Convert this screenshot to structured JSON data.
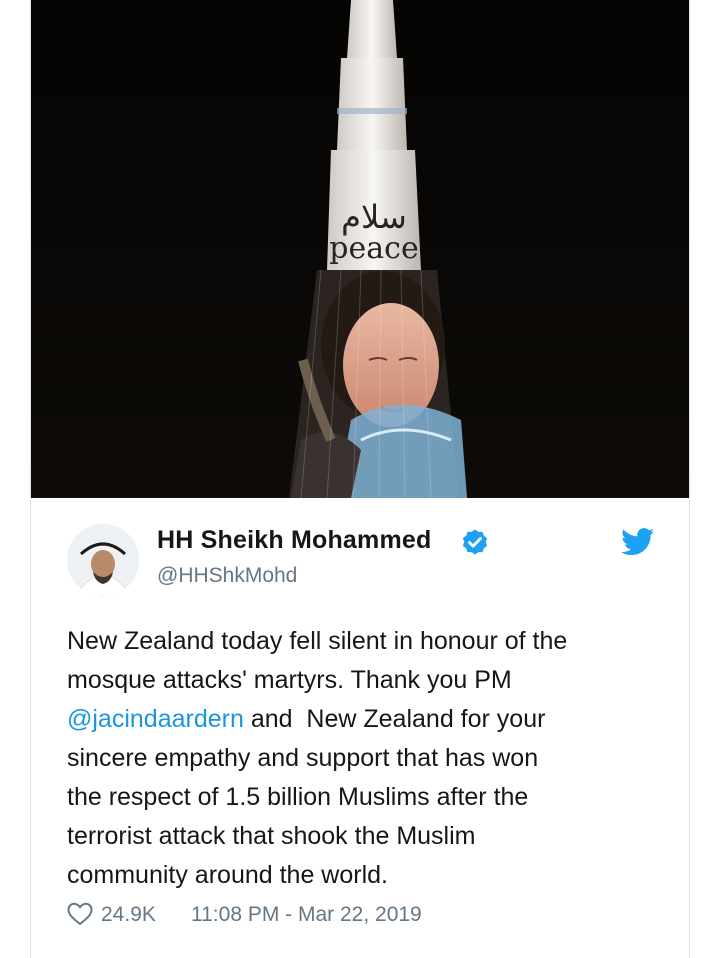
{
  "media": {
    "arabic_text": "سلام",
    "english_text": "peace"
  },
  "author": {
    "display_name": "HH Sheikh Mohammed",
    "handle": "@HHShkMohd"
  },
  "tweet": {
    "lines": [
      {
        "before": "New Zealand today fell silent in honour of the",
        "mention": "",
        "after": ""
      },
      {
        "before": "mosque attacks' martyrs. Thank you PM",
        "mention": "",
        "after": ""
      },
      {
        "before": "",
        "mention": "@jacindaardern",
        "after": " and  New Zealand for your"
      },
      {
        "before": "sincere empathy and support that has won",
        "mention": "",
        "after": ""
      },
      {
        "before": "the respect of 1.5 billion Muslims after the",
        "mention": "",
        "after": ""
      },
      {
        "before": "terrorist attack that shook the Muslim",
        "mention": "",
        "after": ""
      },
      {
        "before": "community around the world.",
        "mention": "",
        "after": ""
      }
    ]
  },
  "footer": {
    "likes": "24.9K",
    "timestamp": "11:08 PM - Mar 22, 2019"
  },
  "colors": {
    "mention": "#1b95e0",
    "verified": "#1da1f2",
    "twitter_brand": "#1da1f2"
  },
  "icons": {
    "verified": "verified-badge-icon",
    "brand": "twitter-bird-icon",
    "like": "heart-icon"
  }
}
